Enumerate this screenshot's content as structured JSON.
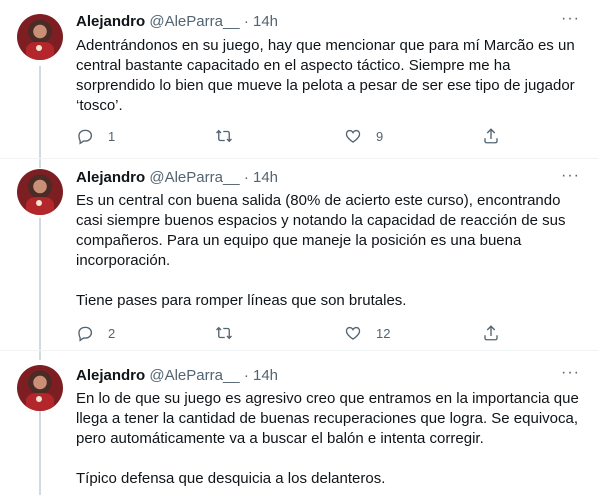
{
  "tweets": [
    {
      "name": "Alejandro",
      "handle": "@AleParra__",
      "dot": "·",
      "time": "14h",
      "paragraphs": [
        "Adentrándonos en su juego, hay que mencionar que para mí Marcão es un central bastante capacitado en el aspecto táctico. Siempre me ha sorprendido lo bien que mueve la pelota a pesar de ser ese tipo de jugador ‘tosco’."
      ],
      "replies": "1",
      "retweets": "",
      "likes": "9"
    },
    {
      "name": "Alejandro",
      "handle": "@AleParra__",
      "dot": "·",
      "time": "14h",
      "paragraphs": [
        "Es un central con buena salida (80% de acierto este curso), encontrando casi siempre buenos espacios y notando la capacidad de reacción de sus compañeros. Para un equipo que maneje la posición es una buena incorporación.",
        "Tiene pases para romper líneas que son brutales."
      ],
      "replies": "2",
      "retweets": "",
      "likes": "12"
    },
    {
      "name": "Alejandro",
      "handle": "@AleParra__",
      "dot": "·",
      "time": "14h",
      "paragraphs": [
        "En lo de que su juego es agresivo creo que entramos en la importancia que llega a tener la cantidad de buenas recuperaciones que logra. Se equivoca, pero automáticamente va a buscar el balón e intenta corregir.",
        "Típico defensa que desquicia a los delanteros."
      ]
    }
  ],
  "more_icon": "···",
  "icons": [
    "reply-icon",
    "retweet-icon",
    "like-icon",
    "share-icon",
    "more-icon"
  ],
  "colors": {
    "text": "#0f1419",
    "secondary": "#536471",
    "thread_line": "#cfd9de"
  }
}
